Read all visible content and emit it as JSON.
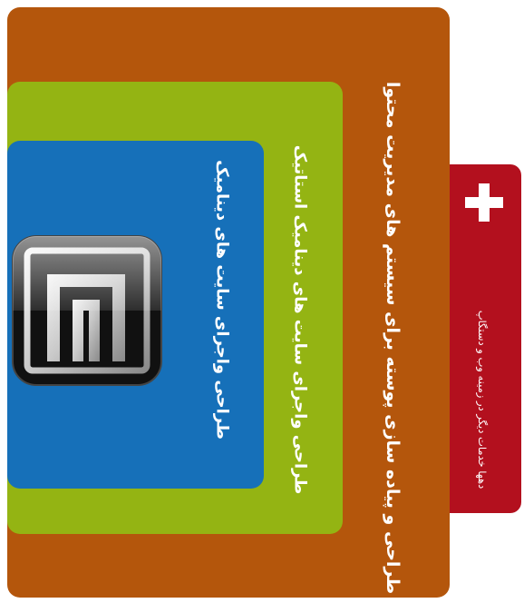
{
  "colors": {
    "outer": "#b4560c",
    "middle": "#94b413",
    "inner": "#1670b9",
    "side": "#b3101e",
    "logo_dark": "#151515",
    "icon": "#ffffff"
  },
  "boxes": {
    "outer_label": "طراحی و پیاده سازی پوسته برای سیستم های مدیریت محتوا",
    "middle_label": "طراحی واجرای سایت های دینامیک استاتیک",
    "inner_label": "طراحی واجرای سایت های دینامیک",
    "side_label": "دهها خدمات دیگر در زمینه وب و دستگاپ"
  },
  "icons": {
    "plus": "plus-icon",
    "logo": "logo-icon"
  }
}
